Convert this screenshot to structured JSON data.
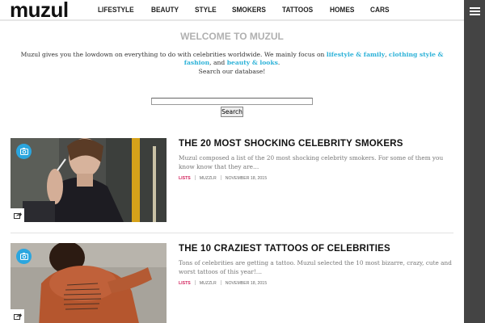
{
  "header": {
    "logo": "muzul",
    "nav": [
      "LIFESTYLE",
      "BEAUTY",
      "STYLE",
      "SMOKERS",
      "TATTOOS",
      "HOMES",
      "CARS"
    ]
  },
  "welcome": {
    "title": "WELCOME TO MUZUL",
    "intro_prefix": "Muzul gives you the lowdown on everything to do with celebrities worldwide. We mainly focus on ",
    "link1": "lifestyle & family",
    "comma1": ", ",
    "link2": "clothing style & fashion",
    "and_text": ", and ",
    "link3": "beauty & looks",
    "period": ".",
    "search_prompt": "Search our database!"
  },
  "search": {
    "input_value": "",
    "button_label": "Search"
  },
  "articles": [
    {
      "title": "THE 20 MOST SHOCKING CELEBRITY SMOKERS",
      "excerpt": "Muzul composed a list of the 20 most shocking celebrity smokers. For some of them you know know that they are…",
      "category": "LISTS",
      "author": "MUZZLR",
      "date": "NOVEMBER 18, 2015"
    },
    {
      "title": "THE 10 CRAZIEST TATTOOS OF CELEBRITIES",
      "excerpt": "Tons of celebrities are getting a tattoo. Muzul selected the 10 most bizarre, crazy, cute and worst tattoos of this year!…",
      "category": "LISTS",
      "author": "MUZZLR",
      "date": "NOVEMBER 18, 2015"
    }
  ],
  "icons": {
    "menu": "hamburger-menu-icon",
    "badge": "camera-icon",
    "share": "share-icon"
  },
  "colors": {
    "accent": "#2db2d8",
    "category": "#d2225c",
    "rail": "#444444",
    "badge": "#2ba6df"
  }
}
